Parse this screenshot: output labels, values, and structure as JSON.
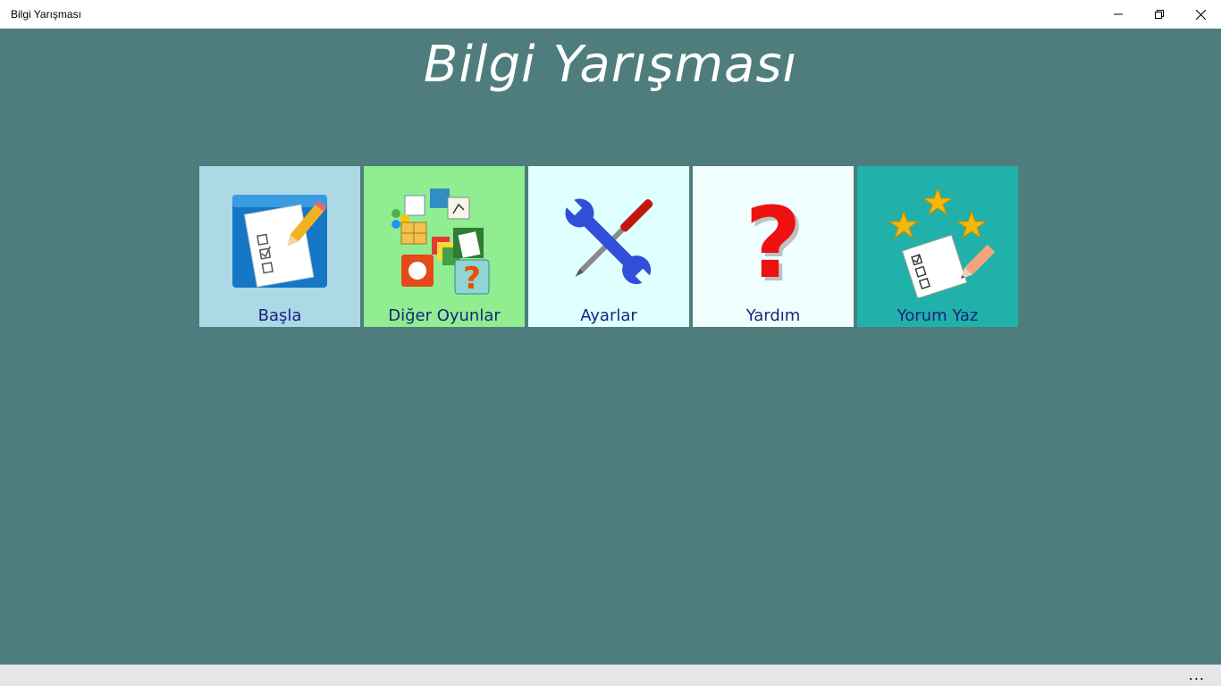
{
  "window": {
    "title": "Bilgi Yarışması",
    "controls": [
      "minimize-icon",
      "restore-icon",
      "close-icon"
    ]
  },
  "heading": "Bilgi Yarışması",
  "tiles": [
    {
      "label": "Başla",
      "icon": "quiz-checklist-icon",
      "color": "#add8e6"
    },
    {
      "label": "Diğer Oyunlar",
      "icon": "games-collection-icon",
      "color": "#90ee90"
    },
    {
      "label": "Ayarlar",
      "icon": "wrench-screwdriver-icon",
      "color": "#e0ffff"
    },
    {
      "label": "Yardım",
      "icon": "question-mark-icon",
      "color": "#f0fffe"
    },
    {
      "label": "Yorum Yaz",
      "icon": "rating-stars-icon",
      "color": "#20b2aa"
    }
  ],
  "appbar": {
    "more": "..."
  },
  "colors": {
    "background": "#4f7d7d",
    "label": "#1a237e"
  }
}
